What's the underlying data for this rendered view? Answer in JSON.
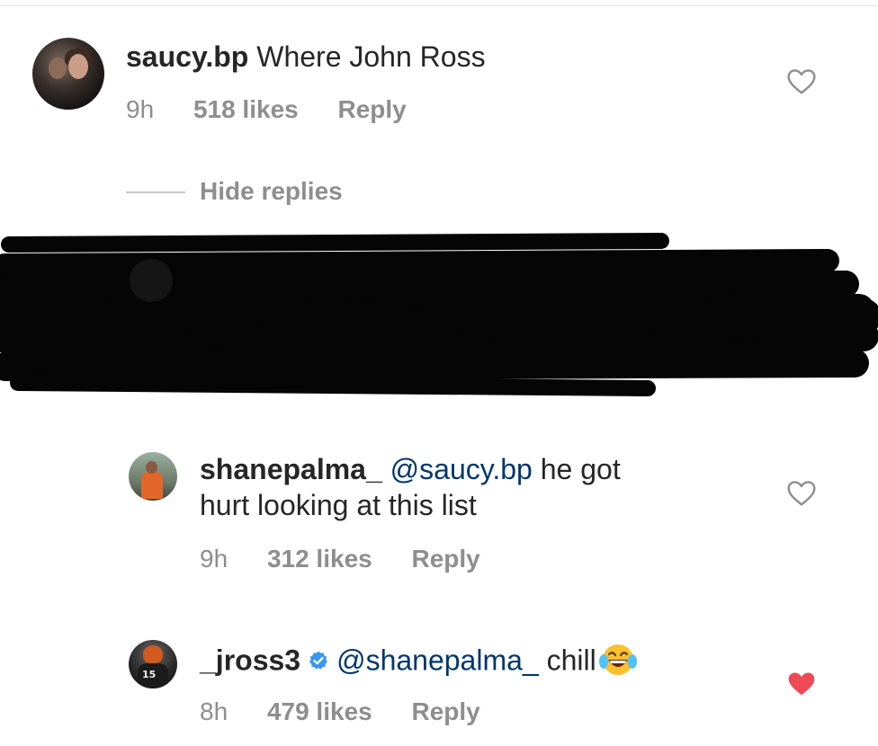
{
  "comments": [
    {
      "username": "saucy.bp",
      "text": "Where John Ross",
      "time": "9h",
      "likes": "518 likes",
      "reply": "Reply",
      "liked": false
    },
    {
      "username": "shanepalma_",
      "mention": "@saucy.bp",
      "text_line1": "he got",
      "text_line2": "hurt looking at this list",
      "time": "9h",
      "likes": "312 likes",
      "reply": "Reply",
      "liked": false
    },
    {
      "username": "_jross3",
      "verified": true,
      "mention": "@shanepalma_",
      "text": "chill",
      "emoji": "face-with-tears-of-joy",
      "time": "8h",
      "likes": "479 likes",
      "reply": "Reply",
      "liked": true
    }
  ],
  "thread": {
    "hide_replies_label": "Hide replies"
  },
  "colors": {
    "mention": "#00376b",
    "meta": "#8e8e8e",
    "liked_heart": "#ed4956",
    "verified": "#3897f0"
  }
}
